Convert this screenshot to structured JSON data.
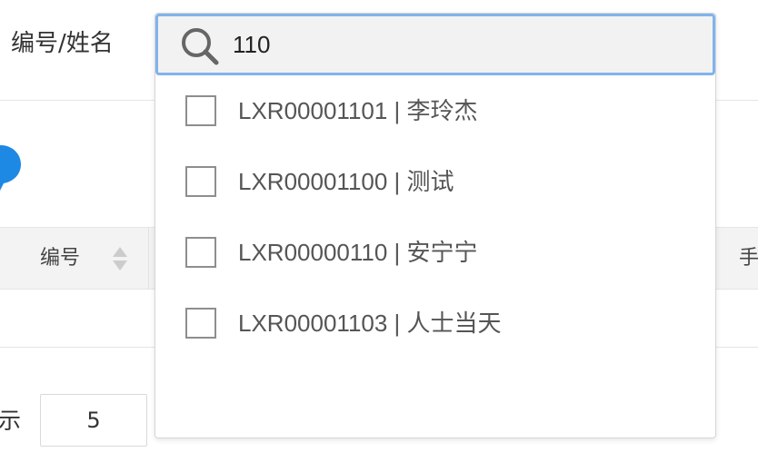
{
  "filter": {
    "label": "编号/姓名"
  },
  "search": {
    "value": "110",
    "options": [
      {
        "label": "LXR00001101 | 李玲杰",
        "checked": false
      },
      {
        "label": "LXR00001100 | 测试",
        "checked": false
      },
      {
        "label": "LXR00000110 | 安宁宁",
        "checked": false
      },
      {
        "label": "LXR00001103 | 人士当天",
        "checked": false
      }
    ]
  },
  "table": {
    "columns": [
      "编号",
      "手"
    ]
  },
  "pagination": {
    "label": "示",
    "page_size": "5"
  },
  "colors": {
    "focus_border": "#80b3ec",
    "help_icon": "#1e88e5",
    "header_bg": "#f3f3f3"
  },
  "icons": [
    "search-icon",
    "help-icon",
    "sort-icon",
    "checkbox-icon"
  ]
}
